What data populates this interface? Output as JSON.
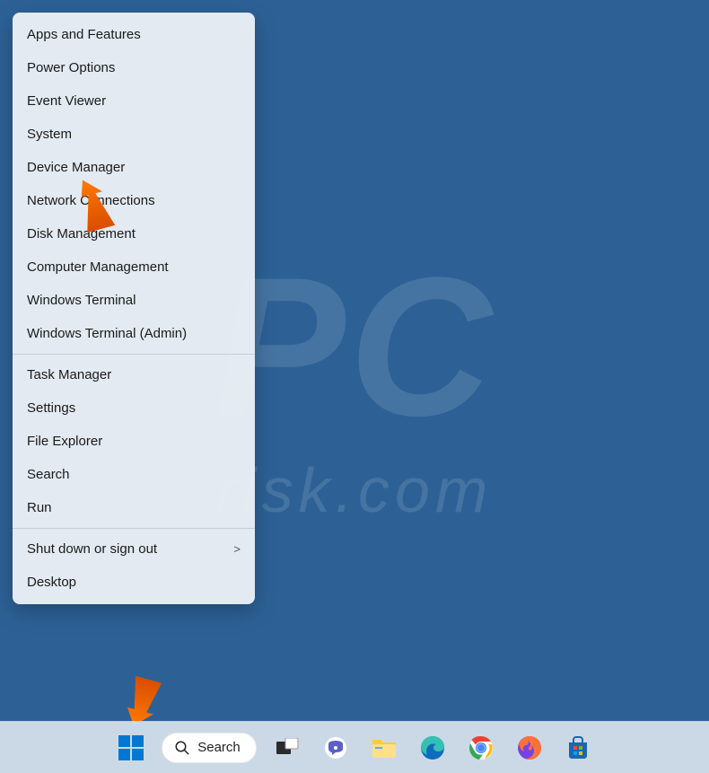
{
  "context_menu": {
    "groups": [
      [
        {
          "label": "Apps and Features",
          "has_sub": false
        },
        {
          "label": "Power Options",
          "has_sub": false
        },
        {
          "label": "Event Viewer",
          "has_sub": false
        },
        {
          "label": "System",
          "has_sub": false
        },
        {
          "label": "Device Manager",
          "has_sub": false
        },
        {
          "label": "Network Connections",
          "has_sub": false
        },
        {
          "label": "Disk Management",
          "has_sub": false
        },
        {
          "label": "Computer Management",
          "has_sub": false
        },
        {
          "label": "Windows Terminal",
          "has_sub": false
        },
        {
          "label": "Windows Terminal (Admin)",
          "has_sub": false
        }
      ],
      [
        {
          "label": "Task Manager",
          "has_sub": false
        },
        {
          "label": "Settings",
          "has_sub": false
        },
        {
          "label": "File Explorer",
          "has_sub": false
        },
        {
          "label": "Search",
          "has_sub": false
        },
        {
          "label": "Run",
          "has_sub": false
        }
      ],
      [
        {
          "label": "Shut down or sign out",
          "has_sub": true
        },
        {
          "label": "Desktop",
          "has_sub": false
        }
      ]
    ]
  },
  "taskbar": {
    "search_label": "Search",
    "apps": [
      {
        "name": "start",
        "title": "Start"
      },
      {
        "name": "search",
        "title": "Search"
      },
      {
        "name": "task-view",
        "title": "Task View"
      },
      {
        "name": "chat",
        "title": "Chat"
      },
      {
        "name": "file-explorer",
        "title": "File Explorer"
      },
      {
        "name": "edge",
        "title": "Microsoft Edge"
      },
      {
        "name": "chrome",
        "title": "Google Chrome"
      },
      {
        "name": "firefox",
        "title": "Firefox"
      },
      {
        "name": "microsoft-store",
        "title": "Microsoft Store"
      }
    ]
  },
  "watermark": {
    "top": "PC",
    "bottom": "risk.com"
  },
  "annotations": {
    "arrow1_target": "Device Manager",
    "arrow2_target": "Start"
  }
}
